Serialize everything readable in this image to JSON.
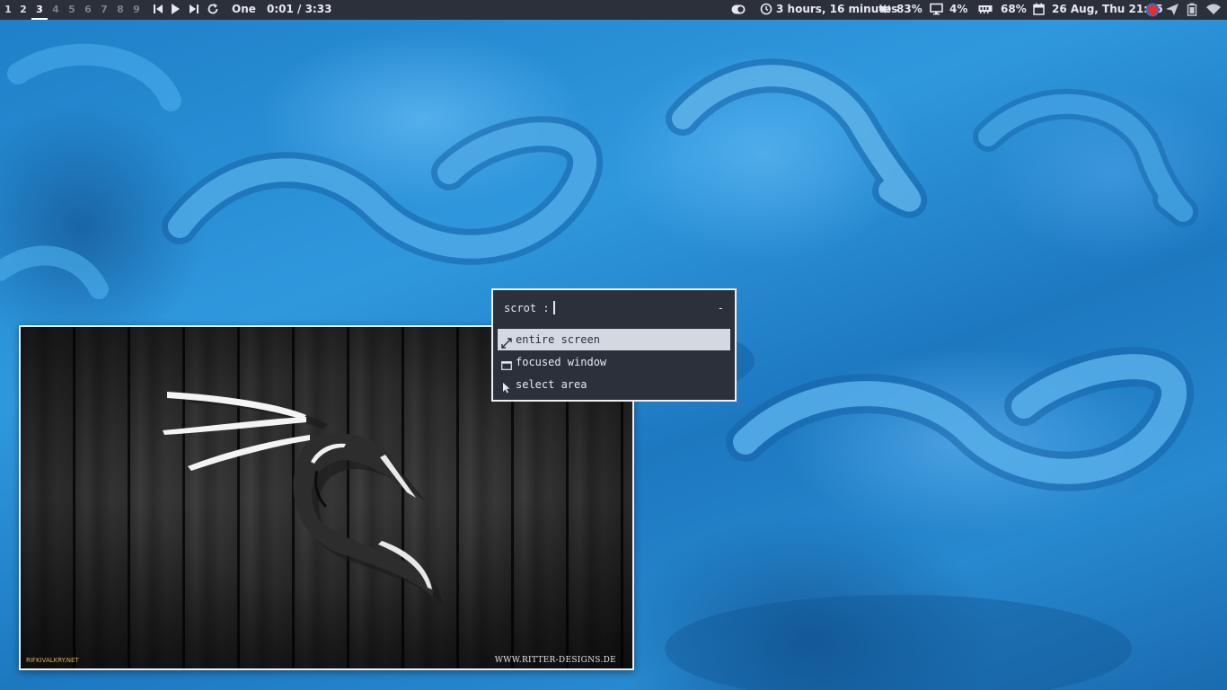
{
  "topbar": {
    "workspaces": [
      {
        "label": "1",
        "state": "occupied"
      },
      {
        "label": "2",
        "state": "occupied"
      },
      {
        "label": "3",
        "state": "focused"
      },
      {
        "label": "4",
        "state": "empty"
      },
      {
        "label": "5",
        "state": "empty"
      },
      {
        "label": "6",
        "state": "empty"
      },
      {
        "label": "7",
        "state": "empty"
      },
      {
        "label": "8",
        "state": "empty"
      },
      {
        "label": "9",
        "state": "empty"
      }
    ],
    "media": {
      "prev_icon": "skip-previous-icon",
      "play_icon": "play-icon",
      "next_icon": "skip-next-icon",
      "repeat_icon": "repeat-icon",
      "track": "One",
      "time": "0:01 / 3:33"
    },
    "status": {
      "toggle_icon": "toggle-icon",
      "uptime": "3 hours, 16 minutes",
      "volume": "83%",
      "cpu": "4%",
      "memory": "68%",
      "datetime": "26 Aug, Thu 21:15"
    },
    "tray_icons": [
      "shield-app-icon",
      "send-icon",
      "battery-icon",
      "wifi-icon"
    ]
  },
  "scrot_menu": {
    "prompt": "scrot :",
    "minimize": "-",
    "options": [
      {
        "label": "entire screen",
        "icon": "expand-arrows-icon",
        "selected": true
      },
      {
        "label": "focused window",
        "icon": "window-icon",
        "selected": false
      },
      {
        "label": "select area",
        "icon": "cursor-icon",
        "selected": false
      }
    ]
  },
  "kali_window": {
    "credit_left": "RIFKIVALKRY.NET",
    "credit_right": "WWW.RITTER-DESIGNS.DE"
  },
  "colors": {
    "bar_bg": "#2b303b",
    "bar_fg": "#e7e9ee",
    "menu_selected_bg": "#d4d8e0",
    "border": "#eceff3",
    "wallpaper_blue": "#2a8fd3"
  }
}
